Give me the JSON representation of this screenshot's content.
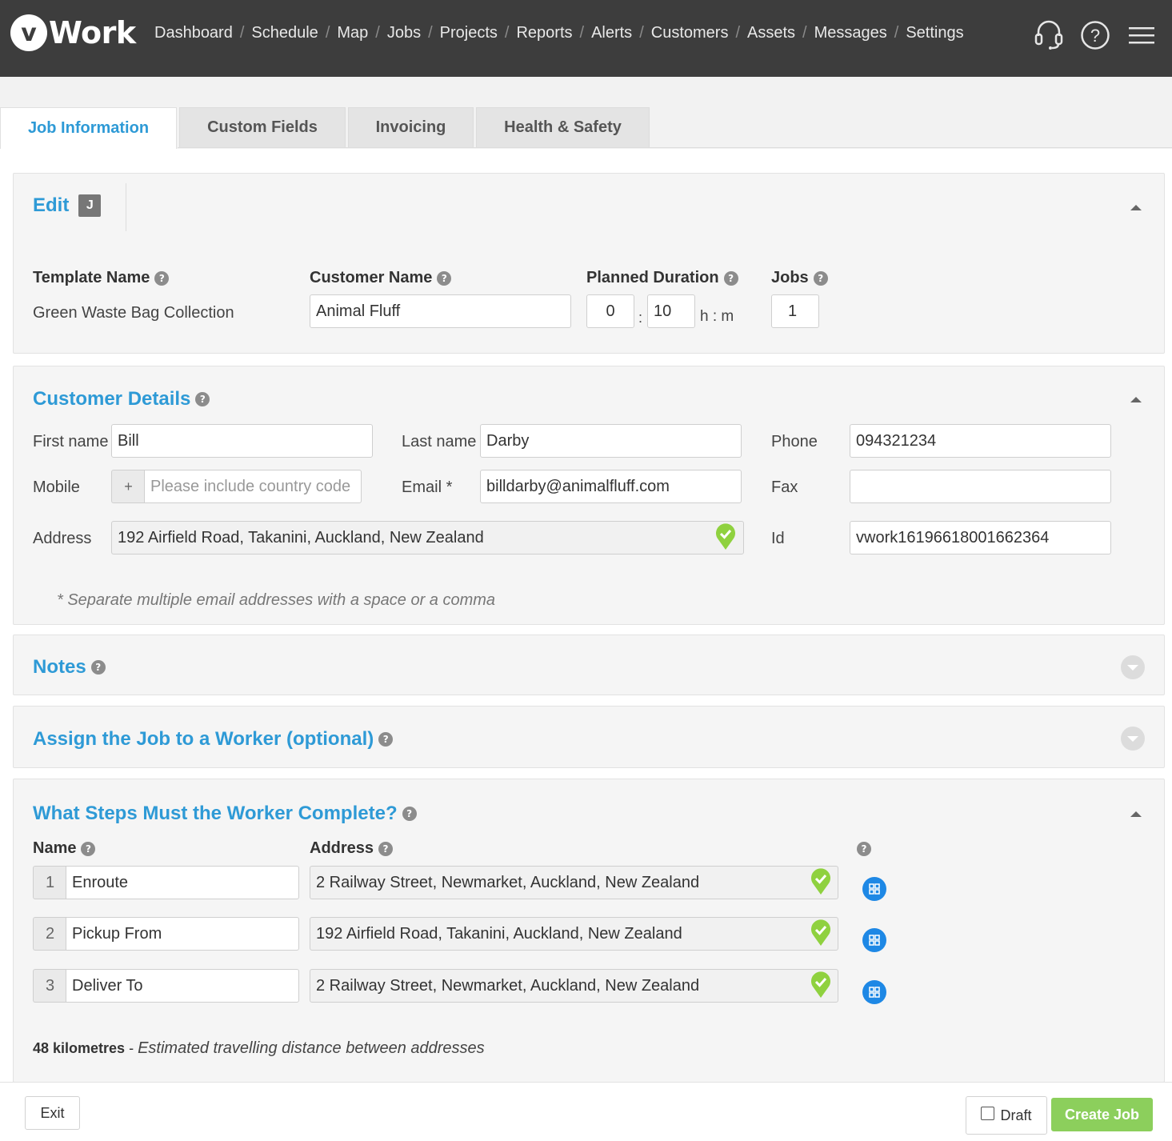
{
  "header": {
    "logo_mark": "v",
    "logo_text": "Work",
    "nav": [
      "Dashboard",
      "Schedule",
      "Map",
      "Jobs",
      "Projects",
      "Reports",
      "Alerts",
      "Customers",
      "Assets",
      "Messages",
      "Settings"
    ],
    "icons": [
      "headset-icon",
      "help-circle-icon",
      "menu-icon"
    ]
  },
  "tabs": [
    "Job Information",
    "Custom Fields",
    "Invoicing",
    "Health & Safety"
  ],
  "edit": {
    "title": "Edit",
    "badge": "J",
    "template_name_label": "Template Name",
    "template_name": "Green Waste Bag Collection",
    "customer_name_label": "Customer Name",
    "customer_name": "Animal Fluff",
    "planned_duration_label": "Planned Duration",
    "duration_hours": "0",
    "duration_minutes": "10",
    "duration_sep": ":",
    "duration_unit": "h : m",
    "jobs_label": "Jobs",
    "jobs": "1"
  },
  "customer": {
    "title": "Customer Details",
    "first_name_label": "First name",
    "first_name": "Bill",
    "last_name_label": "Last name",
    "last_name": "Darby",
    "phone_label": "Phone",
    "phone": "094321234",
    "mobile_label": "Mobile",
    "mobile_prefix": "+",
    "mobile_placeholder": "Please include country code",
    "email_label": "Email *",
    "email": "billdarby@animalfluff.com",
    "fax_label": "Fax",
    "fax": "",
    "address_label": "Address",
    "address": "192 Airfield Road, Takanini, Auckland, New Zealand",
    "id_label": "Id",
    "id": "vwork16196618001662364",
    "note": "* Separate multiple email addresses with a space or a comma"
  },
  "notes": {
    "title": "Notes"
  },
  "assign": {
    "title": "Assign the Job to a Worker (optional)"
  },
  "steps": {
    "title": "What Steps Must the Worker Complete?",
    "name_label": "Name",
    "address_label": "Address",
    "items": [
      {
        "num": "1",
        "name": "Enroute",
        "address": "2 Railway Street, Newmarket, Auckland, New Zealand"
      },
      {
        "num": "2",
        "name": "Pickup From",
        "address": "192 Airfield Road, Takanini, Auckland, New Zealand"
      },
      {
        "num": "3",
        "name": "Deliver To",
        "address": "2 Railway Street, Newmarket, Auckland, New Zealand"
      }
    ],
    "distance": "48 kilometres",
    "distance_sep": " - ",
    "distance_note": "Estimated travelling distance between addresses"
  },
  "footer": {
    "exit_label": "Exit",
    "draft_label": "Draft",
    "create_label": "Create Job"
  },
  "colors": {
    "topbar": "#3d3d3d",
    "accent_blue": "#2e9ad6",
    "create_green": "#8ccf5c",
    "pin_green": "#8fd13f",
    "step_button_blue": "#1e88e5"
  }
}
